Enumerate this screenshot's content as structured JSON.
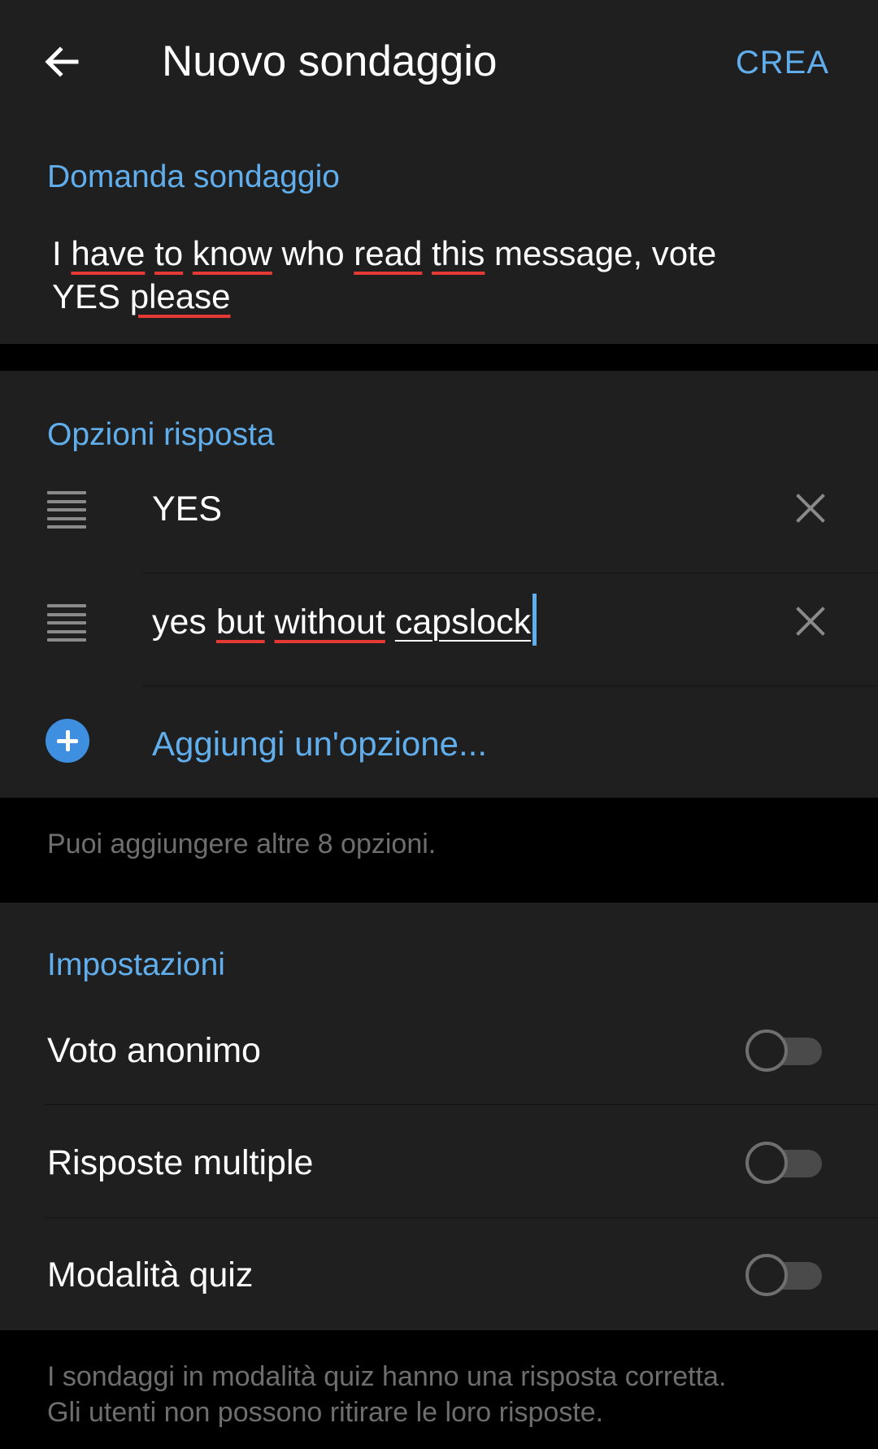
{
  "header": {
    "title": "Nuovo sondaggio",
    "create_label": "CREA"
  },
  "question": {
    "section_label": "Domanda sondaggio",
    "words": [
      "I",
      "have",
      "to",
      "know",
      "who",
      "read",
      "this",
      "message,",
      "vote",
      "YES",
      "please"
    ]
  },
  "options": {
    "section_label": "Opzioni risposta",
    "items": [
      {
        "value": "YES"
      },
      {
        "words": [
          "yes",
          "but",
          "without",
          "capslock"
        ]
      }
    ],
    "add_label": "Aggiungi un'opzione...",
    "hint": "Puoi aggiungere altre 8 opzioni."
  },
  "settings": {
    "section_label": "Impostazioni",
    "items": [
      {
        "label": "Voto anonimo",
        "enabled": false
      },
      {
        "label": "Risposte multiple",
        "enabled": false
      },
      {
        "label": "Modalità quiz",
        "enabled": false
      }
    ],
    "footer_line1": "I sondaggi in modalità quiz hanno una risposta corretta.",
    "footer_line2": "Gli utenti non possono ritirare le loro risposte."
  },
  "colors": {
    "accent": "#61aeec",
    "surface": "#1f1f1f",
    "background": "#000000",
    "spellcheck": "#e53935"
  }
}
